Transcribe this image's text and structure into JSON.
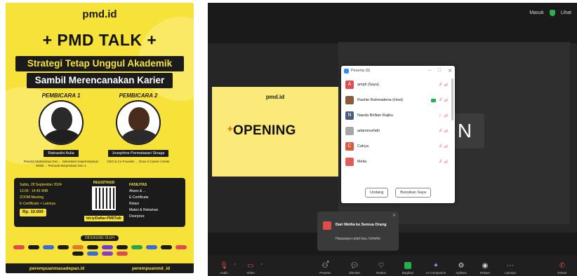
{
  "poster": {
    "domain": "pmd.id",
    "title": "+ PMD TALK +",
    "subtitle_1": "Strategi Tetap Unggul Akademik",
    "subtitle_2": "Sambil Merencanakan Karier",
    "speaker_1": {
      "badge": "PEMBICARA 1",
      "name": "Ratnasilvi Aulia",
      "role": "Peserta Mahasiswa Gen ... Sekretaris Kepemimpinan MSIB ... Pemuda Berprestasi Gen 4"
    },
    "speaker_2": {
      "badge": "PEMBICARA 2",
      "name": "Josephine Permatasari Sinaga",
      "role": "CEO & Co-Founder ... Grow it Career Center"
    },
    "event": {
      "date": "Sabtu, 28 September 2024",
      "time": "13.00 - 14.45 WIB",
      "platform": "ZOOM Meeting",
      "certificate": "E-Certificate + Lainnya",
      "price": "Rp. 10.000"
    },
    "registration": {
      "header": "REGISTRASI",
      "link": "bit.ly/Daftar-PMDTalk"
    },
    "benefits": {
      "header": "FASILITAS",
      "items": [
        "Akses & ...",
        "E-Certificate",
        "Relasi",
        "Materi & Rekaman",
        "Doorprize"
      ]
    },
    "partners_header": "DIDUKUNG OLEH",
    "footer": {
      "instagram": "perempuanmasadepan.id",
      "twitter": "perempuanmd_id"
    }
  },
  "zoom": {
    "top_right": {
      "label_1": "Masuk",
      "label_2": "Lihat"
    },
    "shared_screen": {
      "brand": "pmd.id",
      "title": "OPENING"
    },
    "name_tile": "N",
    "participants_window": {
      "title": "Peserta (9)",
      "participants": [
        {
          "name": "ampli (Saya)",
          "initial": "A",
          "color": "#e04b4b"
        },
        {
          "name": "Rashie Rahmadena (Host)",
          "initial": "",
          "color": "#8a5a3a"
        },
        {
          "name": "Naeda Brillian Rajiku",
          "initial": "N",
          "color": "#4a5d7a"
        },
        {
          "name": "adaminurfath",
          "initial": "",
          "color": "#a7a7a7"
        },
        {
          "name": "Cahya",
          "initial": "C",
          "color": "#d65a3b"
        },
        {
          "name": "Melia",
          "initial": "",
          "color": "#e45b5b"
        }
      ],
      "invite_button": "Undang",
      "unmute_button": "Bunyikan Saya"
    },
    "chat_popup": {
      "from": "Dari Meilia ke Semua Orang",
      "message": "Haaaaaya umpi kau, hehehe"
    },
    "toolbar": {
      "audio": "Audio",
      "video": "Video",
      "participants": "Peserta",
      "participants_count": "9",
      "chat": "Obrolan",
      "react": "Reaksi",
      "share": "Bagikan",
      "companion": "AI Companion",
      "apps": "Aplikasi",
      "record": "Rekam",
      "more": "Lainnya",
      "leave": "Keluar"
    }
  }
}
